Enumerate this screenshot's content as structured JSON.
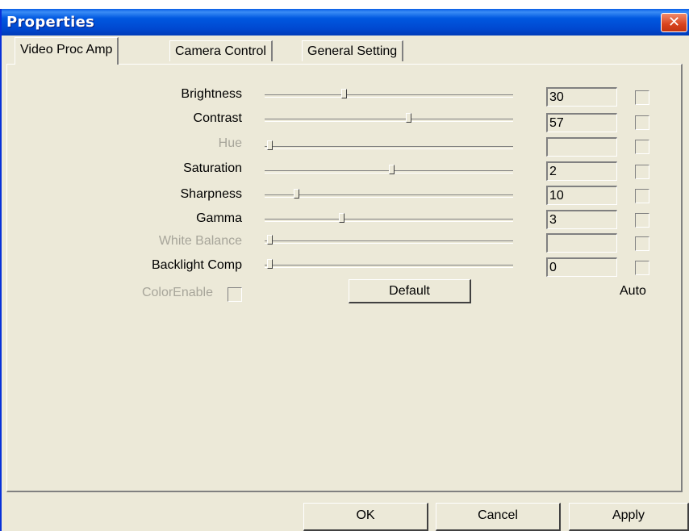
{
  "window": {
    "title": "Properties",
    "close_symbol": "✕"
  },
  "tabs": [
    {
      "label": "Video Proc Amp",
      "active": true
    },
    {
      "label": "Camera Control",
      "active": false
    },
    {
      "label": "General Setting",
      "active": false
    }
  ],
  "controls": [
    {
      "label": "Brightness",
      "value": "30",
      "level": 0.31,
      "enabled": true,
      "auto": false
    },
    {
      "label": "Contrast",
      "value": "57",
      "level": 0.58,
      "enabled": true,
      "auto": false
    },
    {
      "label": "Hue",
      "value": "",
      "level": 0.0,
      "enabled": false,
      "auto": false
    },
    {
      "label": "Saturation",
      "value": "2",
      "level": 0.51,
      "enabled": true,
      "auto": false
    },
    {
      "label": "Sharpness",
      "value": "10",
      "level": 0.11,
      "enabled": true,
      "auto": false
    },
    {
      "label": "Gamma",
      "value": "3",
      "level": 0.3,
      "enabled": true,
      "auto": false
    },
    {
      "label": "White Balance",
      "value": "",
      "level": 0.0,
      "enabled": false,
      "auto": false
    },
    {
      "label": "Backlight Comp",
      "value": "0",
      "level": 0.0,
      "enabled": true,
      "auto": false
    }
  ],
  "color_enable": {
    "label": "ColorEnable",
    "checked": false,
    "enabled": false
  },
  "default_button": "Default",
  "auto_label": "Auto",
  "buttons": {
    "ok": "OK",
    "cancel": "Cancel",
    "apply": "Apply"
  },
  "colors": {
    "face": "#ece9d8",
    "titlebar": "#0058e0",
    "close": "#d8431e",
    "disabled_text": "#a7a59a"
  }
}
